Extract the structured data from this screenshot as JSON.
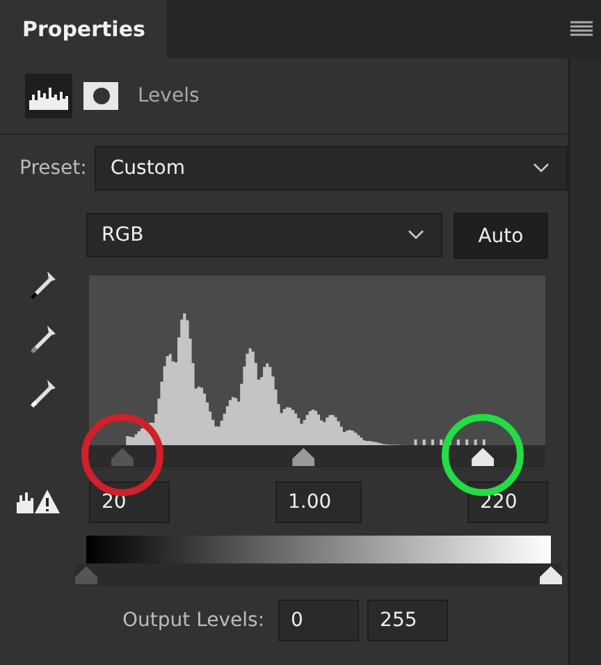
{
  "panel": {
    "title": "Properties",
    "adjustment": "Levels"
  },
  "preset": {
    "label": "Preset:",
    "value": "Custom"
  },
  "channel": {
    "value": "RGB"
  },
  "auto_button": "Auto",
  "input_sliders": [
    {
      "kind": "black",
      "level": 0.073,
      "color": "#d0202a"
    },
    {
      "kind": "gray",
      "level": 0.47
    },
    {
      "kind": "white",
      "level": 0.863,
      "color": "#22dd44"
    }
  ],
  "input_values": [
    "20",
    "1.00",
    "220"
  ],
  "output_sliders": [
    {
      "kind": "black",
      "level": 0
    },
    {
      "kind": "white",
      "level": 1
    }
  ],
  "output": {
    "label": "Output Levels:",
    "values": [
      "0",
      "255"
    ]
  }
}
